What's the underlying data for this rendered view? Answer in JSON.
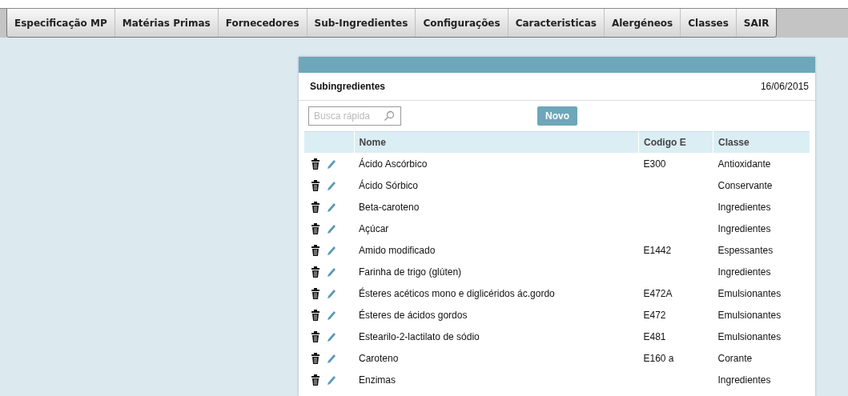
{
  "menu": [
    {
      "label": "Especificação MP"
    },
    {
      "label": "Matérias Primas"
    },
    {
      "label": "Fornecedores"
    },
    {
      "label": "Sub-Ingredientes"
    },
    {
      "label": "Configurações"
    },
    {
      "label": "Caracteristicas"
    },
    {
      "label": "Alergéneos"
    },
    {
      "label": "Classes"
    },
    {
      "label": "SAIR"
    }
  ],
  "panel": {
    "title": "Subingredientes",
    "date": "16/06/2015",
    "search": {
      "placeholder": "Busca rápida"
    },
    "new_button": "Novo",
    "table": {
      "columns": [
        "Nome",
        "Codigo E",
        "Classe"
      ],
      "rows": [
        {
          "nome": "Ácido Ascórbico",
          "codigo": "E300",
          "classe": "Antioxidante"
        },
        {
          "nome": "Ácido Sórbico",
          "codigo": "",
          "classe": "Conservante"
        },
        {
          "nome": "Beta-caroteno",
          "codigo": "",
          "classe": "Ingredientes"
        },
        {
          "nome": "Açúcar",
          "codigo": "",
          "classe": "Ingredientes"
        },
        {
          "nome": "Amido modificado",
          "codigo": "E1442",
          "classe": "Espessantes"
        },
        {
          "nome": "Farinha de trigo (glúten)",
          "codigo": "",
          "classe": "Ingredientes"
        },
        {
          "nome": "Ésteres acéticos mono e diglicéridos ác.gordo",
          "codigo": "E472A",
          "classe": "Emulsionantes"
        },
        {
          "nome": "Ésteres de ácidos gordos",
          "codigo": "E472",
          "classe": "Emulsionantes"
        },
        {
          "nome": "Estearilo-2-lactilato de sódio",
          "codigo": "E481",
          "classe": "Emulsionantes"
        },
        {
          "nome": "Caroteno",
          "codigo": "E160 a",
          "classe": "Corante"
        },
        {
          "nome": "Enzimas",
          "codigo": "",
          "classe": "Ingredientes"
        }
      ]
    }
  }
}
